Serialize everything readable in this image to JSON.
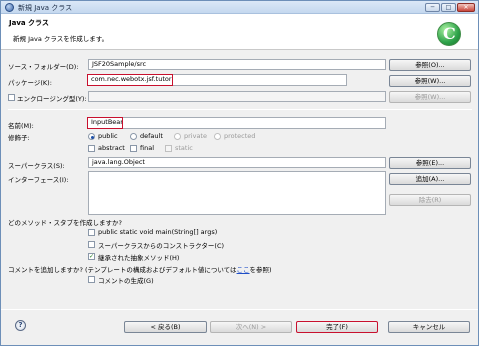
{
  "window": {
    "title": "新規 Java クラス",
    "minimize": "─",
    "maximize": "□",
    "close": "✕"
  },
  "header": {
    "title": "Java クラス",
    "subtitle": "新規 Java クラスを作成します。",
    "logo_glyph": "C"
  },
  "form": {
    "source_folder": {
      "label": "ソース・フォルダー(D):",
      "value": "JSF20Sample/src",
      "button": "参照(O)..."
    },
    "package": {
      "label": "パッケージ(K):",
      "value": "com.nec.webotx.jsf.tutorial",
      "button": "参照(W)..."
    },
    "enclosing": {
      "label": "エンクロージング型(Y):",
      "value": "",
      "button": "参照(W)...",
      "checked": false
    },
    "name": {
      "label": "名前(M):",
      "value": "InputBean"
    },
    "modifiers": {
      "label": "修飾子:",
      "public": "public",
      "default": "default",
      "private": "private",
      "protected": "protected",
      "abstract": "abstract",
      "final": "final",
      "static": "static",
      "selected_access": "public",
      "abstract_checked": false,
      "final_checked": false,
      "static_checked": false
    },
    "superclass": {
      "label": "スーパークラス(S):",
      "value": "java.lang.Object",
      "button": "参照(E)..."
    },
    "interfaces": {
      "label": "インターフェース(I):",
      "add_button": "追加(A)...",
      "remove_button": "除去(R)"
    },
    "stubs": {
      "question": "どのメソッド・スタブを作成しますか?",
      "main": "public static void main(String[] args)",
      "constructors": "スーパークラスからのコンストラクター(C)",
      "inherited": "継承された抽象メソッド(H)",
      "main_checked": false,
      "constructors_checked": false,
      "inherited_checked": true
    },
    "comments": {
      "question_prefix": "コメントを追加しますか? (テンプレートの構成およびデフォルト値については",
      "link": "ここ",
      "question_suffix": "を参照)",
      "generate": "コメントの生成(G)",
      "generate_checked": false
    }
  },
  "footer": {
    "help": "?",
    "back": "< 戻る(B)",
    "next": "次へ(N) >",
    "finish": "完了(F)",
    "cancel": "キャンセル"
  },
  "colors": {
    "highlight": "#c8102e",
    "title_gradient": "#c4d8ef",
    "logo": "#2ea34a"
  }
}
